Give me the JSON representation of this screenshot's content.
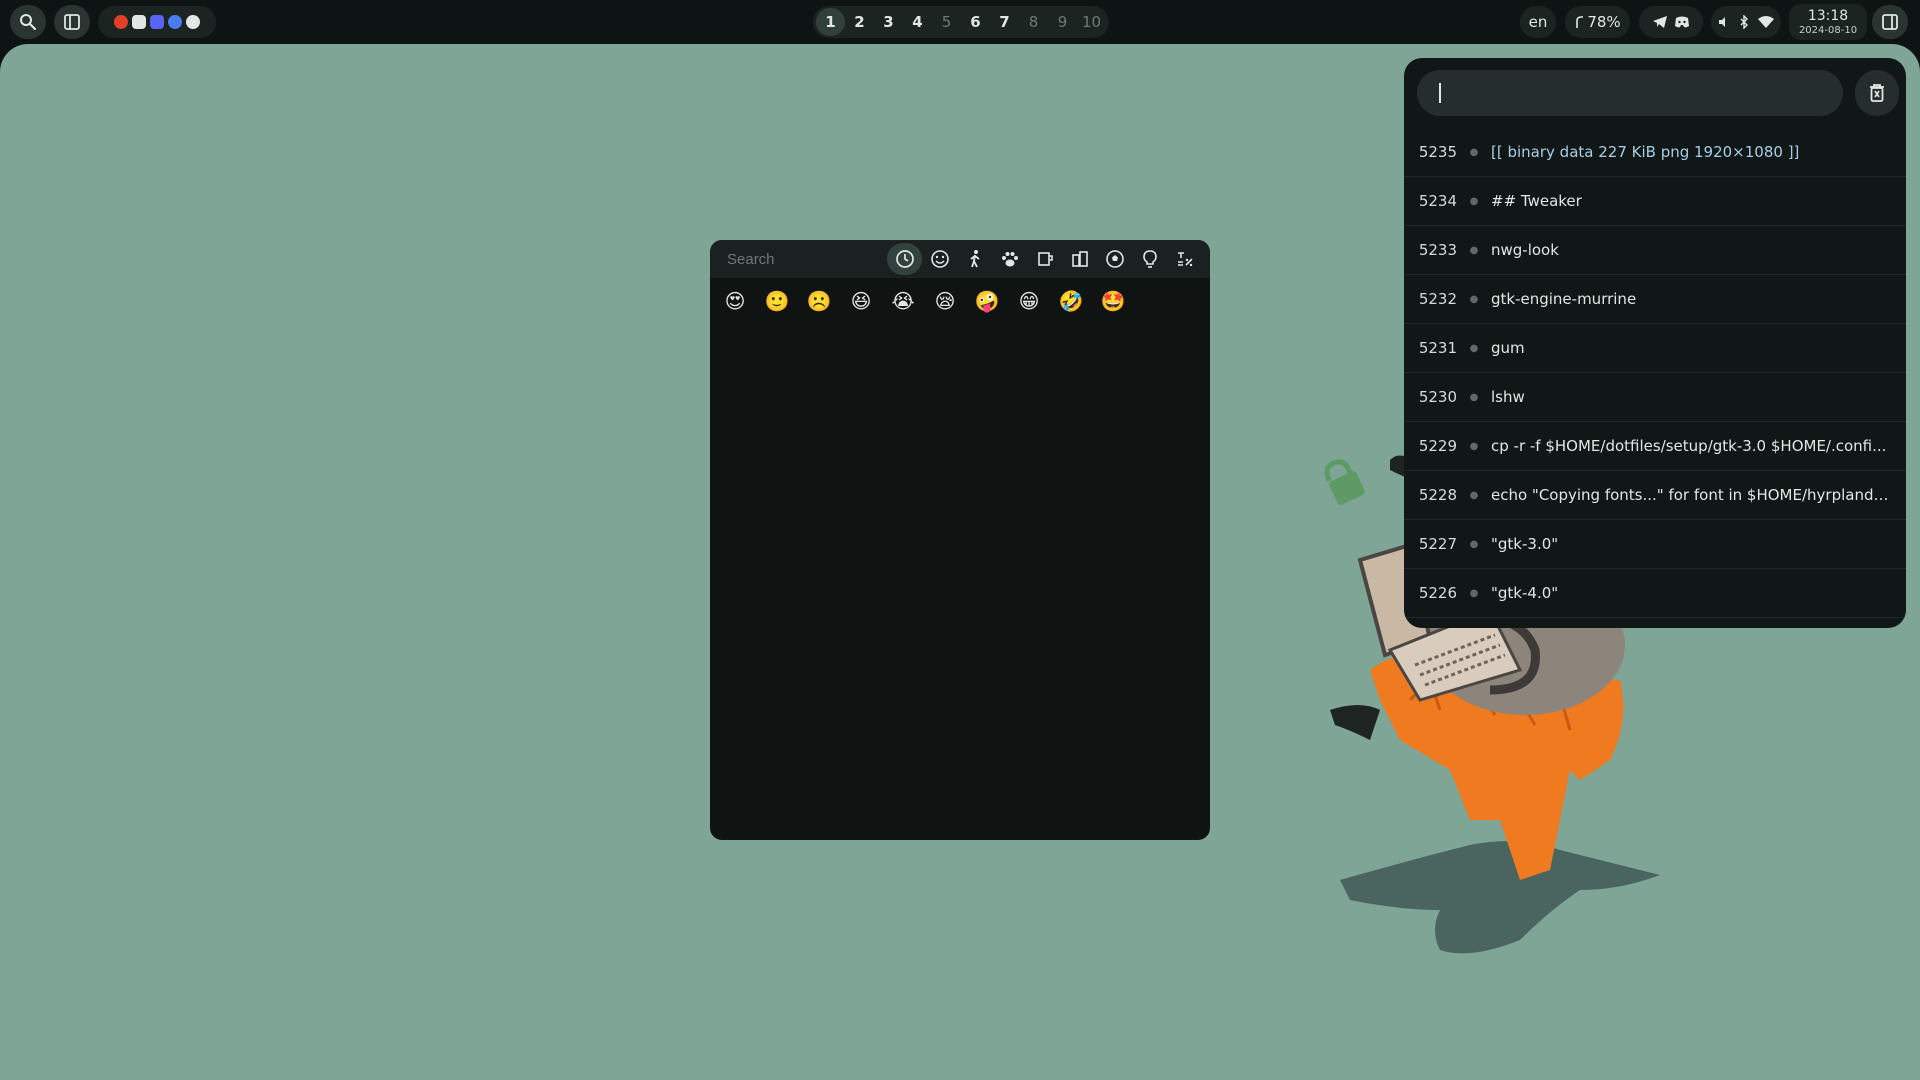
{
  "topbar": {
    "workspaces": [
      "1",
      "2",
      "3",
      "4",
      "5",
      "6",
      "7",
      "8",
      "9",
      "10"
    ],
    "active_workspace": "1",
    "dim_workspaces": [
      "5",
      "8",
      "9",
      "10"
    ],
    "language": "en",
    "battery": "78%",
    "time": "13:18",
    "date": "2024-08-10"
  },
  "emoji_picker": {
    "search_placeholder": "Search",
    "categories": [
      "recent",
      "smileys",
      "people",
      "animals",
      "food",
      "travel",
      "activities",
      "objects",
      "symbols"
    ],
    "recent_emojis": [
      "😍",
      "🙂",
      "☹️",
      "😆",
      "😭",
      "😪",
      "🤪",
      "😁",
      "🤣",
      "🤩"
    ]
  },
  "clipboard": {
    "items": [
      {
        "id": "5235",
        "text": "[[ binary data 227 KiB png 1920×1080 ]]",
        "binary": true
      },
      {
        "id": "5234",
        "text": "## Tweaker"
      },
      {
        "id": "5233",
        "text": "nwg-look"
      },
      {
        "id": "5232",
        "text": "gtk-engine-murrine"
      },
      {
        "id": "5231",
        "text": "gum"
      },
      {
        "id": "5230",
        "text": "lshw"
      },
      {
        "id": "5229",
        "text": "cp -r -f $HOME/dotfiles/setup/gtk-3.0 $HOME/.confi..."
      },
      {
        "id": "5228",
        "text": "echo \"Copying fonts...\" for font in $HOME/hyrpland/as..."
      },
      {
        "id": "5227",
        "text": "\"gtk-3.0\""
      },
      {
        "id": "5226",
        "text": "\"gtk-4.0\""
      }
    ]
  },
  "colors": {
    "desktop": "#7fa596",
    "bar": "#0e1413",
    "panel": "#111716",
    "accent_orange": "#f07a1f"
  }
}
